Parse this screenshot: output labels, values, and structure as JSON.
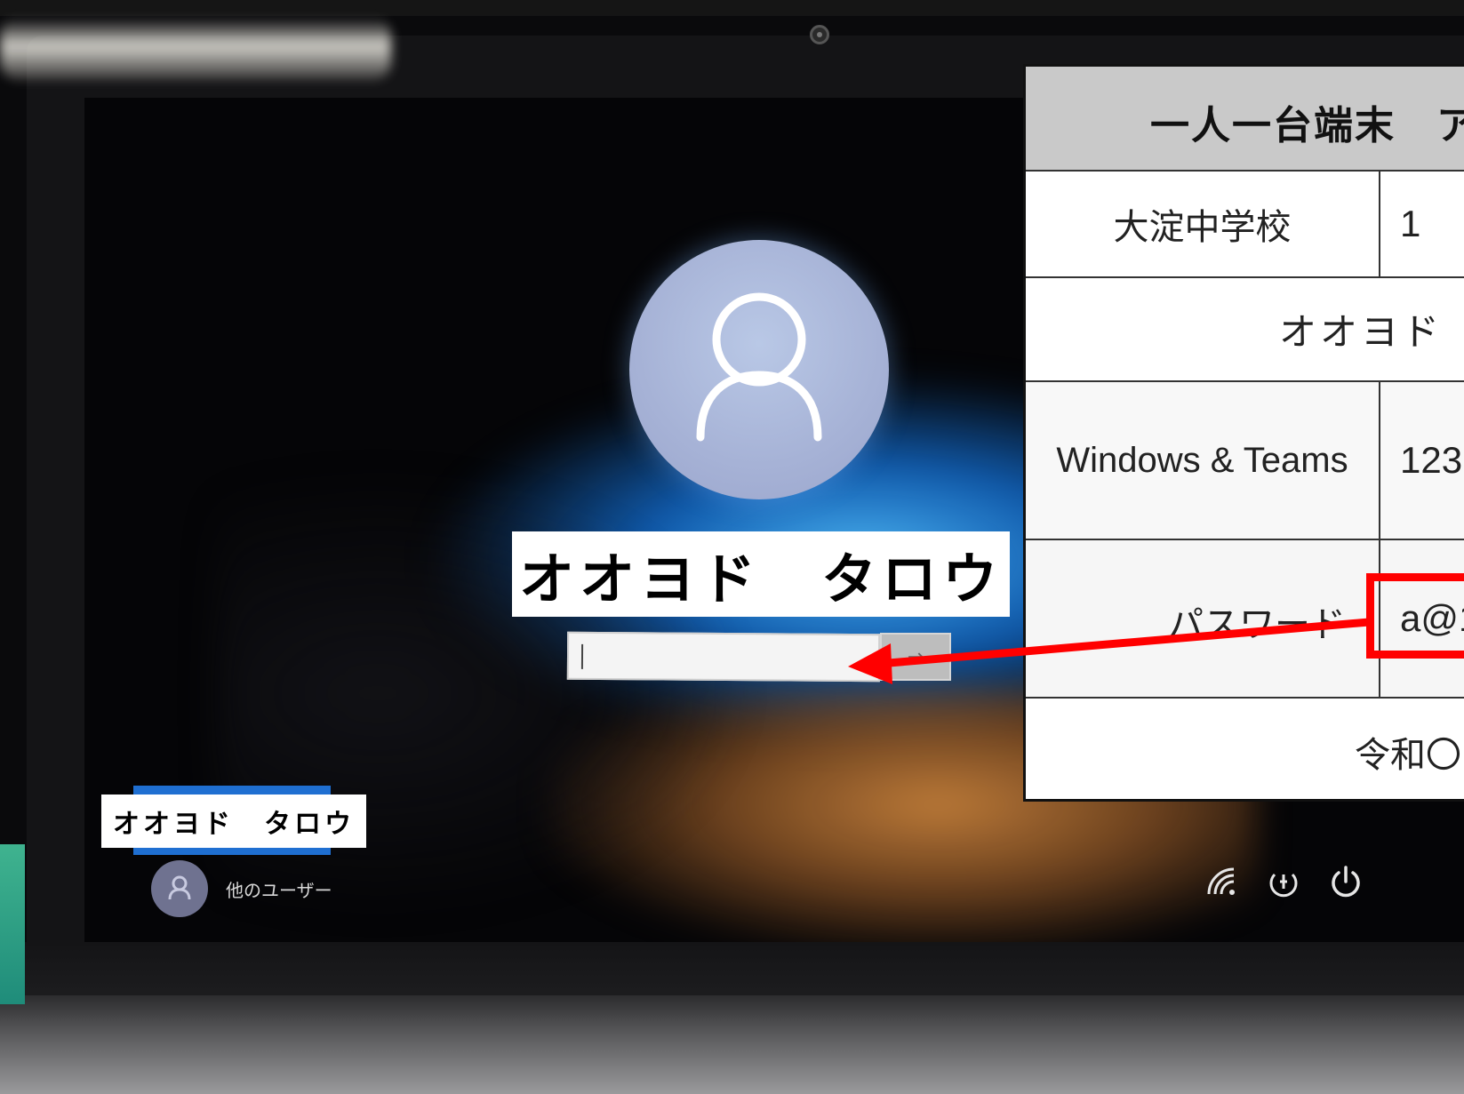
{
  "login": {
    "user_name": "オオヨド　タロウ",
    "password_value": "",
    "submit_icon": "arrow-right-icon"
  },
  "user_list": {
    "selected_user": "オオヨド　タロウ",
    "other_user_label": "他のユーザー"
  },
  "system_icons": [
    "network-icon",
    "accessibility-icon",
    "power-icon"
  ],
  "account_card": {
    "title": "一人一台端末　ア",
    "school": "大淀中学校",
    "grade": "1",
    "name_kana": "オオヨド",
    "service_label": "Windows & Teams",
    "service_id": "123",
    "password_label": "パスワード",
    "password_value": "a@1",
    "date": "令和〇"
  },
  "colors": {
    "highlight_red": "#ff0000",
    "selected_user_blue": "#1f6fd1"
  }
}
